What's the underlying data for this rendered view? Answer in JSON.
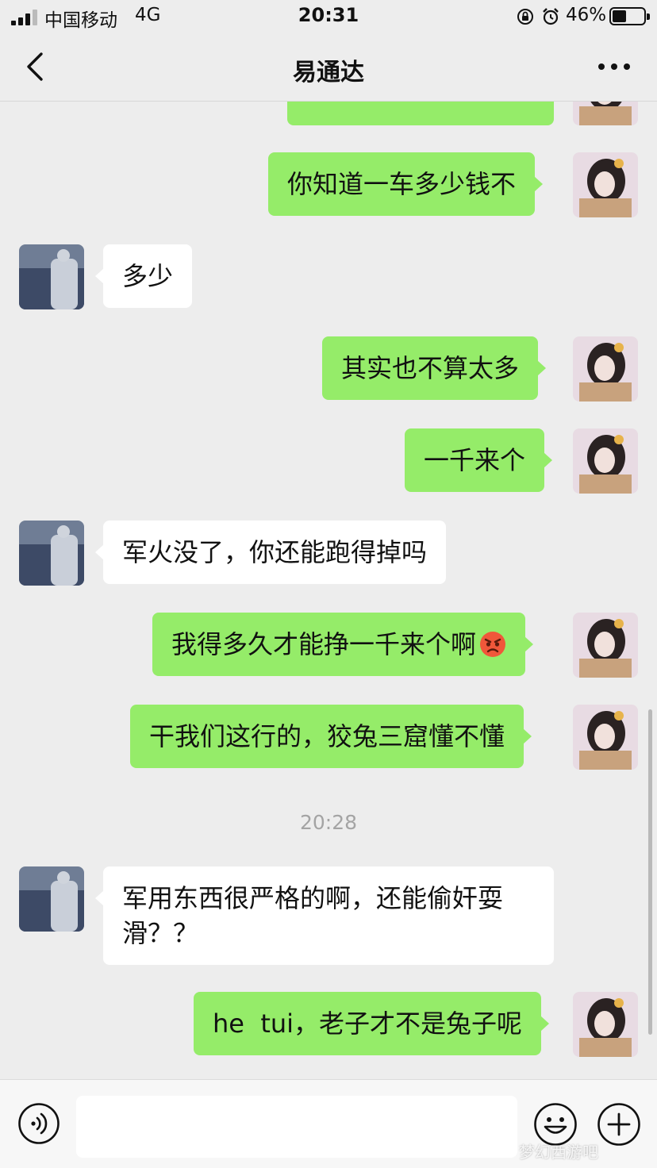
{
  "status_bar": {
    "carrier": "中国移动",
    "network": "4G",
    "time": "20:31",
    "battery": "46%",
    "battery_level": 0.46
  },
  "nav": {
    "title": "易通达",
    "back_icon": "chevron-left-icon",
    "more_icon": "ellipsis-icon"
  },
  "messages": [
    {
      "side": "right",
      "text": "…"
    },
    {
      "side": "right",
      "text": "你知道一车多少钱不"
    },
    {
      "side": "left",
      "text": "多少"
    },
    {
      "side": "right",
      "text": "其实也不算太多"
    },
    {
      "side": "right",
      "text": "一千来个"
    },
    {
      "side": "left",
      "text": "军火没了，你还能跑得掉吗"
    },
    {
      "side": "right",
      "text": "我得多久才能挣一千来个啊",
      "emoji": "angry-face-icon"
    },
    {
      "side": "right",
      "text": "干我们这行的，狡兔三窟懂不懂"
    },
    {
      "side": "left",
      "text": "军用东西很严格的啊，还能偷奸耍滑？？"
    },
    {
      "side": "right",
      "text": "he  tui，老子才不是兔子呢"
    }
  ],
  "timestamp": "20:28",
  "input_bar": {
    "voice_icon": "voice-icon",
    "emoji_icon": "emoji-icon",
    "plus_icon": "plus-icon",
    "input_value": ""
  },
  "watermark": "梦幻西游吧",
  "colors": {
    "background": "#ededed",
    "bubble_sent": "#95ec69",
    "bubble_received": "#ffffff"
  }
}
